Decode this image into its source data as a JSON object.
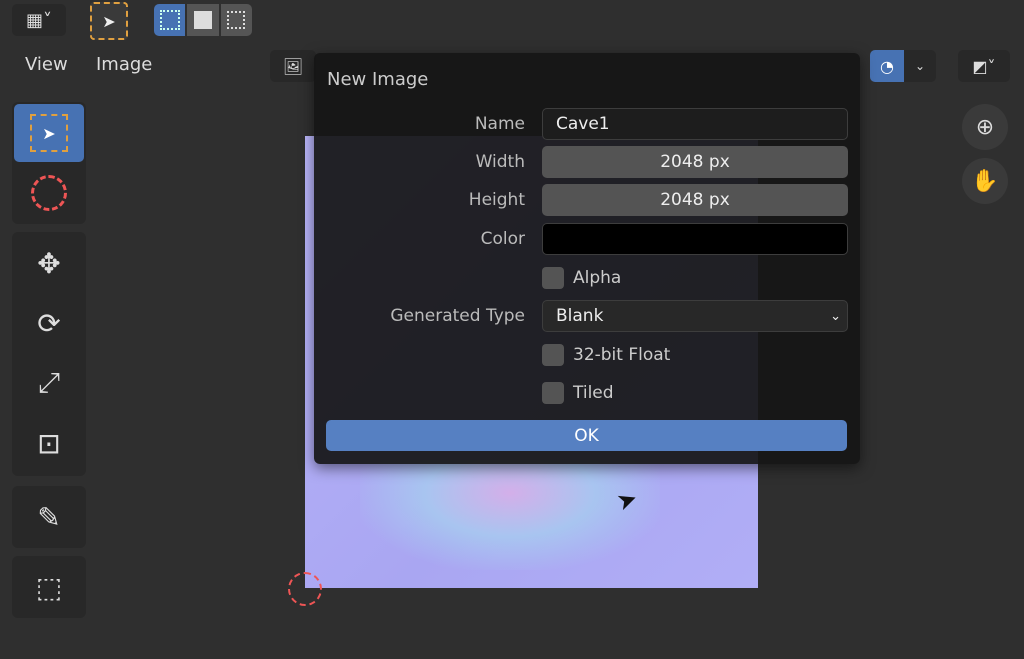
{
  "header": {
    "menus": [
      "View",
      "Image"
    ]
  },
  "dialog": {
    "title": "New Image",
    "name_label": "Name",
    "name_value": "Cave1",
    "width_label": "Width",
    "width_value": "2048 px",
    "height_label": "Height",
    "height_value": "2048 px",
    "color_label": "Color",
    "color_value": "#000000",
    "alpha_label": "Alpha",
    "alpha_checked": false,
    "generated_type_label": "Generated Type",
    "generated_type_value": "Blank",
    "float_label": "32-bit Float",
    "float_checked": false,
    "tiled_label": "Tiled",
    "tiled_checked": false,
    "ok_label": "OK"
  },
  "colors": {
    "accent": "#4772b3",
    "ok_button": "#5680c2"
  }
}
